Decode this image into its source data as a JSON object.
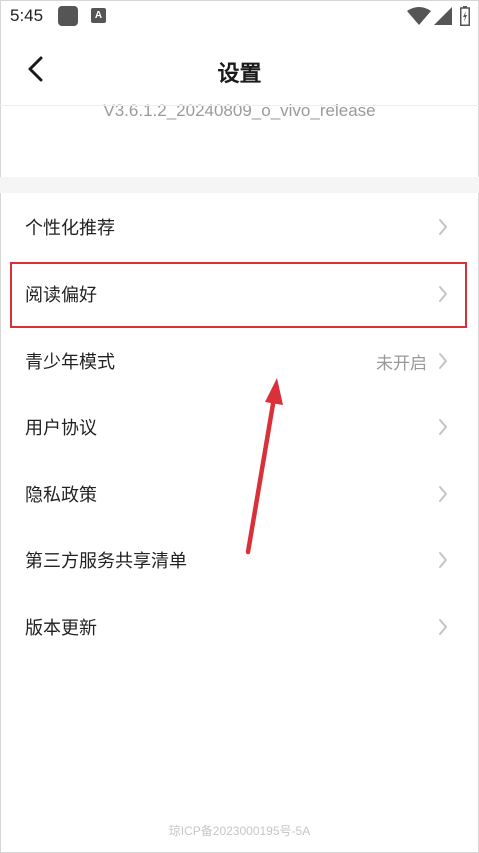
{
  "status_bar": {
    "time": "5:45",
    "a_icon_letter": "A",
    "icons": [
      "app-icon",
      "a-icon",
      "wifi-icon",
      "signal-icon",
      "battery-icon"
    ]
  },
  "header": {
    "title": "设置",
    "back_icon": "chevron-left-icon"
  },
  "version": "V3.6.1.2_20240809_o_vivo_release",
  "menu": [
    {
      "label": "个性化推荐",
      "value": ""
    },
    {
      "label": "阅读偏好",
      "value": ""
    },
    {
      "label": "青少年模式",
      "value": "未开启"
    },
    {
      "label": "用户协议",
      "value": ""
    },
    {
      "label": "隐私政策",
      "value": ""
    },
    {
      "label": "第三方服务共享清单",
      "value": ""
    },
    {
      "label": "版本更新",
      "value": ""
    }
  ],
  "annotations": {
    "highlighted_item": "阅读偏好",
    "highlight_color": "#d9303a",
    "arrow_color": "#d9303a"
  },
  "footer": {
    "icp": "琼ICP备2023000195号-5A"
  },
  "colors": {
    "background": "#ffffff",
    "section_gap": "#f5f5f5",
    "text_primary": "#222222",
    "text_secondary": "#999999",
    "chevron": "#c4c4c4"
  }
}
